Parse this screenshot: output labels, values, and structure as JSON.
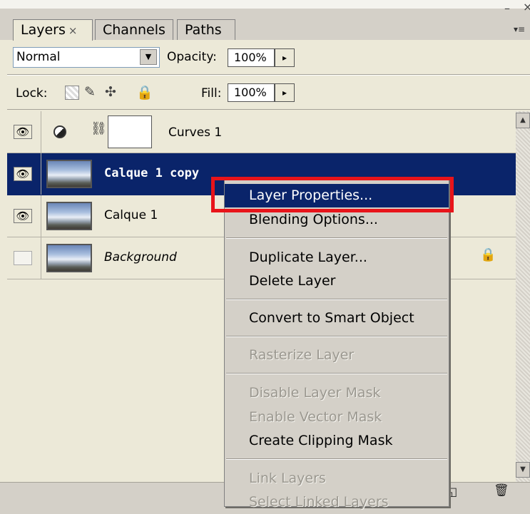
{
  "tabs": [
    {
      "label": "Layers",
      "close": "×"
    },
    {
      "label": "Channels"
    },
    {
      "label": "Paths"
    }
  ],
  "window": {
    "minimize": "–",
    "close": "×",
    "panel_menu": "▾≡"
  },
  "blend": {
    "mode": "Normal",
    "dropdown_icon": "▼"
  },
  "opacity": {
    "label": "Opacity:",
    "value": "100%",
    "arrow": "▸"
  },
  "lock": {
    "label": "Lock:",
    "icons": [
      "lock-transparent-icon",
      "lock-brush-icon",
      "lock-move-icon",
      "lock-all-icon"
    ],
    "brush_glyph": "✎",
    "move_glyph": "✣",
    "all_glyph": "🔒"
  },
  "fill": {
    "label": "Fill:",
    "value": "100%",
    "arrow": "▸"
  },
  "layers": [
    {
      "name": "Curves 1",
      "visible": true,
      "type": "adjustment"
    },
    {
      "name": "Calque 1 copy",
      "visible": true,
      "selected": true
    },
    {
      "name": "Calque 1",
      "visible": true
    },
    {
      "name": "Background",
      "visible": false,
      "locked": true
    }
  ],
  "eye_glyph": "👁",
  "link_glyph": "⛓",
  "lock_glyph": "🔒",
  "context_menu": {
    "items": [
      {
        "label": "Layer Properties...",
        "highlighted": true
      },
      {
        "label": "Blending Options..."
      },
      {
        "label": "Duplicate Layer..."
      },
      {
        "label": "Delete Layer"
      },
      {
        "label": "Convert to Smart Object"
      },
      {
        "label": "Rasterize Layer",
        "disabled": true
      },
      {
        "label": "Disable Layer Mask",
        "disabled": true
      },
      {
        "label": "Enable Vector Mask",
        "disabled": true
      },
      {
        "label": "Create Clipping Mask"
      },
      {
        "label": "Link Layers",
        "disabled": true
      },
      {
        "label": "Select Linked Layers",
        "disabled": true
      }
    ]
  },
  "scrollbar": {
    "up": "▲",
    "down": "▼"
  },
  "bottom_bar": {
    "new_layer_glyph": "◱",
    "trash_glyph": "🗑"
  },
  "colors": {
    "selection": "#0a246a",
    "highlight_box": "#e8141a",
    "panel_bg": "#ece9d8"
  }
}
